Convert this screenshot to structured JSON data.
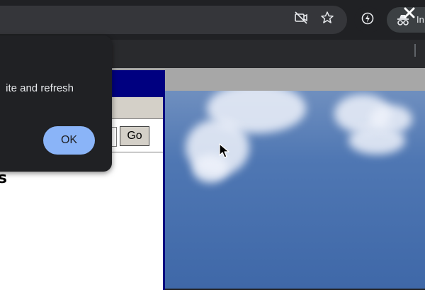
{
  "browser": {
    "icons": {
      "camera_off": "camera-off-icon",
      "bookmark_star": "bookmark-star-icon",
      "extension": "extension-icon",
      "incognito": "incognito-icon",
      "close": "close-icon"
    },
    "incognito_label": "In"
  },
  "page": {
    "go_button_label": "Go",
    "heading_fragment": "ns"
  },
  "dialog": {
    "message_fragment": "ite and refresh",
    "ok_label": "OK"
  },
  "colors": {
    "accent": "#8ab4f8",
    "chrome_dark": "#202124",
    "window_title_blue": "#000080"
  }
}
